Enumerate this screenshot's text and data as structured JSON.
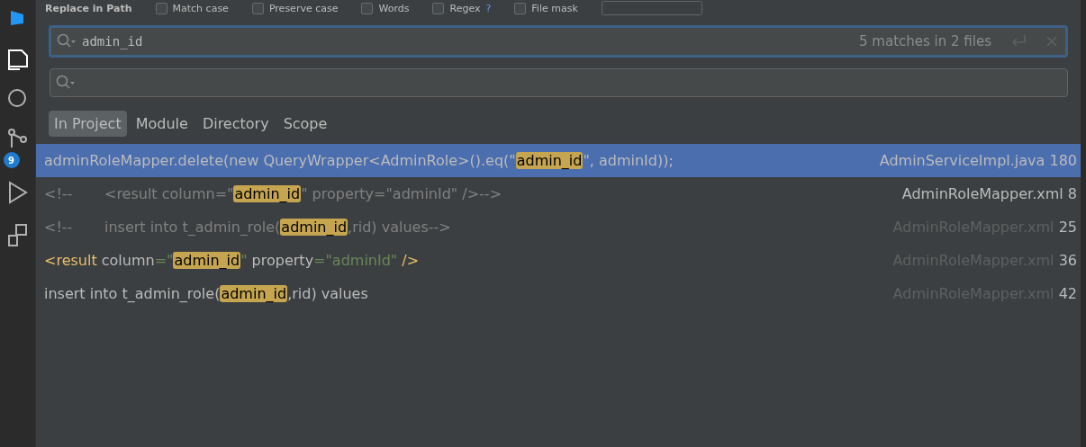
{
  "sidebar": {
    "badge": "9",
    "items": [
      {
        "kind": "file",
        "selected": true
      },
      {
        "kind": "search",
        "selected": false
      },
      {
        "kind": "git",
        "selected": false
      },
      {
        "kind": "run",
        "selected": false
      },
      {
        "kind": "structure",
        "selected": false
      }
    ]
  },
  "dialog": {
    "title": "Replace in Path",
    "options": [
      {
        "label": "Match case",
        "checked": false
      },
      {
        "label": "Preserve case",
        "checked": false
      },
      {
        "label": "Words",
        "checked": false
      },
      {
        "label": "Regex",
        "checked": false,
        "help": "?"
      },
      {
        "label": "File mask",
        "checked": false
      }
    ],
    "search": {
      "value": "admin_id",
      "status": "5 matches in 2 files"
    },
    "scopes": [
      {
        "label": "In Project",
        "selected": true
      },
      {
        "label": "Module",
        "selected": false
      },
      {
        "label": "Directory",
        "selected": false
      },
      {
        "label": "Scope",
        "selected": false
      }
    ],
    "results": [
      {
        "selected": true,
        "dimmed": false,
        "file": "AdminServiceImpl.java",
        "line": "180",
        "segments": [
          {
            "kind": "plain",
            "text": "adminRoleMapper.delete(new QueryWrapper<AdminRole>().eq(\""
          },
          {
            "kind": "match",
            "text": "admin_id"
          },
          {
            "kind": "plain",
            "text": "\", adminId));"
          }
        ]
      },
      {
        "selected": false,
        "dimmed": false,
        "file": "AdminRoleMapper.xml",
        "line": "8",
        "segments": [
          {
            "kind": "comment",
            "text": "<!--       <result column=\""
          },
          {
            "kind": "match",
            "text": "admin_id"
          },
          {
            "kind": "comment",
            "text": "\" property=\"adminId\" />-->"
          }
        ]
      },
      {
        "selected": false,
        "dimmed": true,
        "file": "AdminRoleMapper.xml",
        "line": "25",
        "segments": [
          {
            "kind": "comment",
            "text": "<!--       insert into t_admin_role("
          },
          {
            "kind": "match",
            "text": "admin_id"
          },
          {
            "kind": "comment",
            "text": ",rid) values-->"
          }
        ]
      },
      {
        "selected": false,
        "dimmed": true,
        "file": "AdminRoleMapper.xml",
        "line": "36",
        "segments": [
          {
            "kind": "tag",
            "text": "<result"
          },
          {
            "kind": "plain",
            "text": " column"
          },
          {
            "kind": "string",
            "text": "=\""
          },
          {
            "kind": "match",
            "text": "admin_id"
          },
          {
            "kind": "string",
            "text": "\""
          },
          {
            "kind": "plain",
            "text": " property"
          },
          {
            "kind": "string",
            "text": "=\"adminId\""
          },
          {
            "kind": "tag",
            "text": " />"
          }
        ]
      },
      {
        "selected": false,
        "dimmed": true,
        "file": "AdminRoleMapper.xml",
        "line": "42",
        "segments": [
          {
            "kind": "plain",
            "text": "insert into t_admin_role("
          },
          {
            "kind": "match",
            "text": "admin_id"
          },
          {
            "kind": "plain",
            "text": ",rid) values"
          }
        ]
      }
    ]
  }
}
